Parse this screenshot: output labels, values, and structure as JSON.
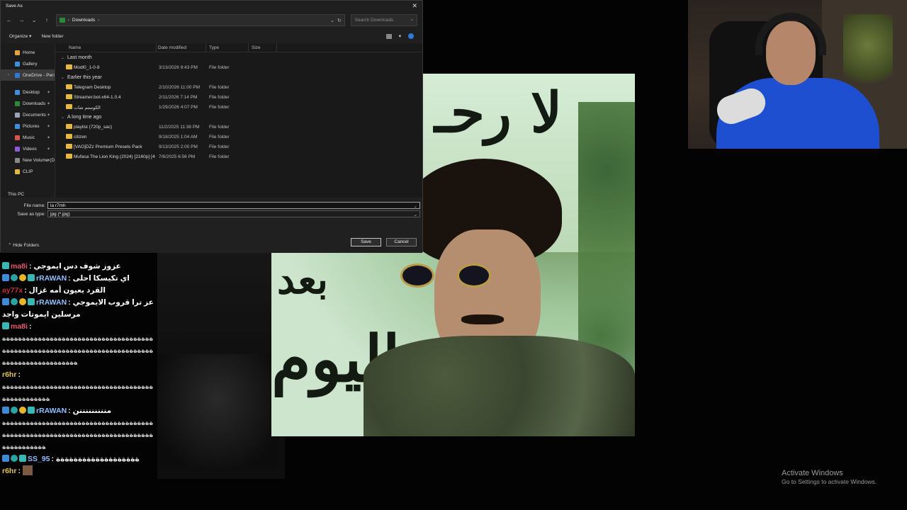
{
  "dialog": {
    "title": "Save As",
    "close_glyph": "✕",
    "nav": {
      "back": "←",
      "forward": "→",
      "dropdown": "⌄",
      "up": "↑"
    },
    "address": {
      "path": "Downloads",
      "chevron": "›"
    },
    "search_placeholder": "Search Downloads",
    "toolbar": {
      "organize": "Organize ▾",
      "new_folder": "New folder"
    },
    "sidebar": [
      {
        "label": "Home",
        "icon": "home-icon",
        "color": "#e8a33a"
      },
      {
        "label": "Gallery",
        "icon": "gallery-icon",
        "color": "#3f8ed8"
      },
      {
        "label": "OneDrive - Pers",
        "icon": "cloud-icon",
        "color": "#2f7ad6",
        "selected": true
      },
      {
        "label": "Desktop",
        "icon": "desktop-icon",
        "color": "#3f8ed8",
        "pinned": true
      },
      {
        "label": "Downloads",
        "icon": "download-icon",
        "color": "#2a8a3a",
        "pinned": true
      },
      {
        "label": "Documents",
        "icon": "document-icon",
        "color": "#9aa6b4",
        "pinned": true
      },
      {
        "label": "Pictures",
        "icon": "pictures-icon",
        "color": "#3f8ed8",
        "pinned": true
      },
      {
        "label": "Music",
        "icon": "music-icon",
        "color": "#d9534f",
        "pinned": true
      },
      {
        "label": "Videos",
        "icon": "videos-icon",
        "color": "#8a5cd6",
        "pinned": true
      },
      {
        "label": "New Volume (D:",
        "icon": "drive-icon",
        "color": "#888888",
        "pinned": true
      },
      {
        "label": "CLIP",
        "icon": "folder-icon",
        "color": "#e6b840"
      }
    ],
    "this_pc": "This PC",
    "columns": {
      "name": "Name",
      "date": "Date modified",
      "type": "Type",
      "size": "Size"
    },
    "groups": [
      {
        "label": "Last month",
        "rows": [
          {
            "name": "Modl0_1-0-9",
            "date": "3/13/2026 9:43 PM",
            "type": "File folder"
          }
        ]
      },
      {
        "label": "Earlier this year",
        "rows": [
          {
            "name": "Telegram Desktop",
            "date": "2/10/2026 11:00 PM",
            "type": "File folder"
          },
          {
            "name": "Streamer.bot-x64-1.0.4",
            "date": "2/11/2026 7:14 PM",
            "type": "File folder"
          },
          {
            "name": "الكوستم شات",
            "date": "1/29/2026 4:07 PM",
            "type": "File folder"
          }
        ]
      },
      {
        "label": "A long time ago",
        "rows": [
          {
            "name": "playlist (720p_sac)",
            "date": "11/2/2025 11:38 PM",
            "type": "File folder"
          },
          {
            "name": "citizen",
            "date": "9/18/2025 1:04 AM",
            "type": "File folder"
          },
          {
            "name": "[VAG]DZz Premium Presets Pack",
            "date": "9/13/2025 2:00 PM",
            "type": "File folder"
          },
          {
            "name": "Mufasa The Lion King (2024) [2160p] [4K]...",
            "date": "7/6/2025 6:56 PM",
            "type": "File folder"
          }
        ]
      }
    ],
    "file_name_label": "File name:",
    "file_name_value": "la r7mh",
    "save_type_label": "Save as type:",
    "save_type_value": "jpg (*.jpg)",
    "hide_folders": "Hide Folders",
    "save_button": "Save",
    "cancel_button": "Cancel"
  },
  "meme": {
    "text_top": "لا رحـ",
    "text_mid": "بعد",
    "text_bottom": "اليوم"
  },
  "chat": {
    "messages": [
      {
        "user": "ma8i",
        "color": "#e35c6e",
        "badges": [
          "gem"
        ],
        "text": ": عزوز شوف دس ايموجي"
      },
      {
        "user": "rRAWAN",
        "color": "#8ec0ff",
        "badges": [
          "sub",
          "heart",
          "one",
          "gem"
        ],
        "text": ": اي تكيسكا احلى"
      },
      {
        "user": "ay77x",
        "color": "#c0303a",
        "badges": [],
        "text": ": القرد بعيون أمه غزال"
      },
      {
        "user": "rRAWAN",
        "color": "#8ec0ff",
        "badges": [
          "sub",
          "heart",
          "one",
          "gem"
        ],
        "text": ": عز ترا قروب الايموجي مرسلين ايموتات واجد"
      },
      {
        "user": "ma8i",
        "color": "#e35c6e",
        "badges": [
          "gem"
        ],
        "text": ":",
        "spam": "ةةةةةةةةةةةةةةةةةةةةةةةةةةةةةةةةةةةةةةةةةةةةةةةةةةةةةةةةةةةةةةةةةةةةةةةةةةةةةةةةةةةةةةةةةةةةةةة"
      },
      {
        "user": "r6hr",
        "color": "#e6c35a",
        "badges": [],
        "text": ":",
        "spam": "ةةةةةةةةةةةةةةةةةةةةةةةةةةةةةةةةةةةةةةةةةةةةةةةةةة"
      },
      {
        "user": "rRAWAN",
        "color": "#8ec0ff",
        "badges": [
          "sub",
          "heart",
          "one",
          "gem"
        ],
        "text": ": منننننننننن",
        "spam": "ةةةةةةةةةةةةةةةةةةةةةةةةةةةةةةةةةةةةةةةةةةةةةةةةةةةةةةةةةةةةةةةةةةةةةةةةةةةةةةةةةةةةةةة"
      },
      {
        "user": "SS_95",
        "color": "#8ec0ff",
        "badges": [
          "sub",
          "heart",
          "gem"
        ],
        "text": ": ةةةةةةةةةةةةةةةةةةة"
      },
      {
        "user": "r6hr",
        "color": "#e6c35a",
        "badges": [],
        "text": ":",
        "avatar": true
      }
    ]
  },
  "watermark": {
    "line1": "Activate Windows",
    "line2": "Go to Settings to activate Windows."
  }
}
